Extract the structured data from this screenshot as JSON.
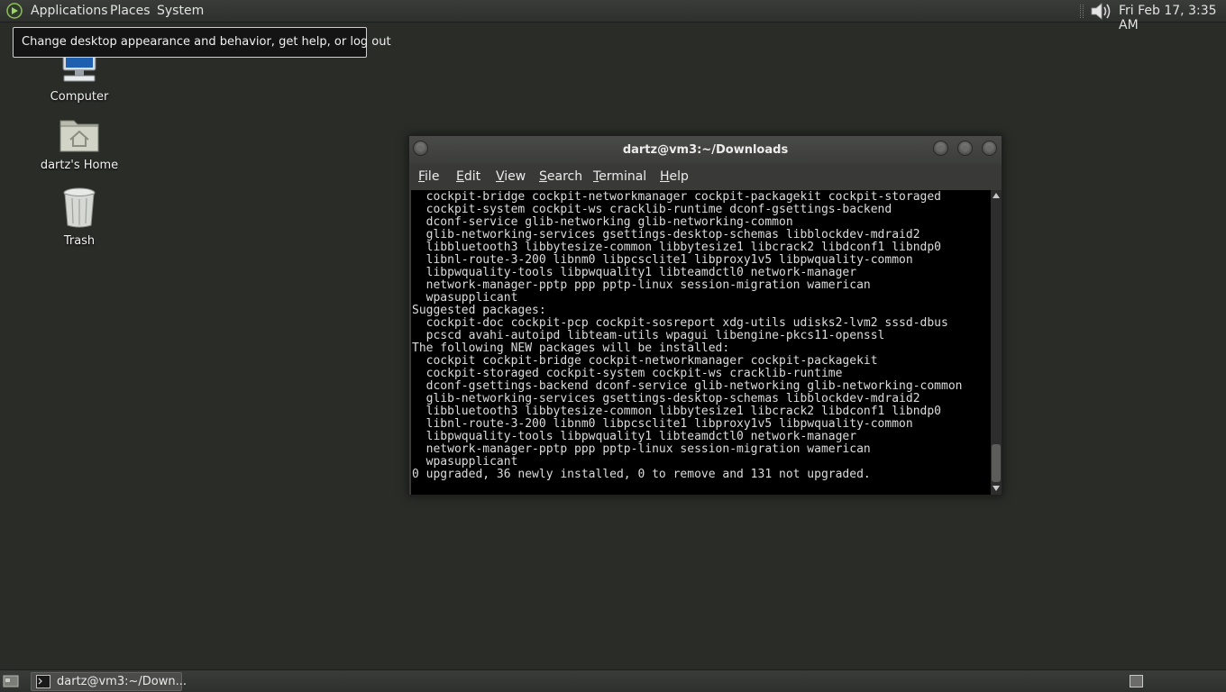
{
  "top_panel": {
    "menus": [
      "Applications",
      "Places",
      "System"
    ],
    "clock": "Fri Feb 17,  3:35 AM"
  },
  "tooltip": {
    "text": "Change desktop appearance and behavior, get help, or log out"
  },
  "desktop": {
    "icons": [
      {
        "label": "Computer",
        "icon": "computer-icon"
      },
      {
        "label": "dartz's Home",
        "icon": "home-folder-icon"
      },
      {
        "label": "Trash",
        "icon": "trash-icon"
      }
    ]
  },
  "terminal_window": {
    "title": "dartz@vm3:~/Downloads",
    "menus": [
      {
        "label": "File",
        "mnemonic": "F",
        "rest": "ile"
      },
      {
        "label": "Edit",
        "mnemonic": "E",
        "rest": "dit"
      },
      {
        "label": "View",
        "mnemonic": "V",
        "rest": "iew"
      },
      {
        "label": "Search",
        "mnemonic": "S",
        "rest": "earch"
      },
      {
        "label": "Terminal",
        "mnemonic": "T",
        "rest": "erminal"
      },
      {
        "label": "Help",
        "mnemonic": "H",
        "rest": "elp"
      }
    ],
    "lines": [
      "  cockpit-bridge cockpit-networkmanager cockpit-packagekit cockpit-storaged",
      "  cockpit-system cockpit-ws cracklib-runtime dconf-gsettings-backend",
      "  dconf-service glib-networking glib-networking-common",
      "  glib-networking-services gsettings-desktop-schemas libblockdev-mdraid2",
      "  libbluetooth3 libbytesize-common libbytesize1 libcrack2 libdconf1 libndp0",
      "  libnl-route-3-200 libnm0 libpcsclite1 libproxy1v5 libpwquality-common",
      "  libpwquality-tools libpwquality1 libteamdctl0 network-manager",
      "  network-manager-pptp ppp pptp-linux session-migration wamerican",
      "  wpasupplicant",
      "Suggested packages:",
      "  cockpit-doc cockpit-pcp cockpit-sosreport xdg-utils udisks2-lvm2 sssd-dbus",
      "  pcscd avahi-autoipd libteam-utils wpagui libengine-pkcs11-openssl",
      "The following NEW packages will be installed:",
      "  cockpit cockpit-bridge cockpit-networkmanager cockpit-packagekit",
      "  cockpit-storaged cockpit-system cockpit-ws cracklib-runtime",
      "  dconf-gsettings-backend dconf-service glib-networking glib-networking-common",
      "  glib-networking-services gsettings-desktop-schemas libblockdev-mdraid2",
      "  libbluetooth3 libbytesize-common libbytesize1 libcrack2 libdconf1 libndp0",
      "  libnl-route-3-200 libnm0 libpcsclite1 libproxy1v5 libpwquality-common",
      "  libpwquality-tools libpwquality1 libteamdctl0 network-manager",
      "  network-manager-pptp ppp pptp-linux session-migration wamerican",
      "  wpasupplicant",
      "0 upgraded, 36 newly installed, 0 to remove and 131 not upgraded."
    ]
  },
  "bottom_panel": {
    "task_label": "dartz@vm3:~/Down..."
  },
  "colors": {
    "desktop_bg": "#2a2c28",
    "panel_bg": "#343634",
    "terminal_bg": "#000000",
    "terminal_fg": "#dcdcdc"
  }
}
